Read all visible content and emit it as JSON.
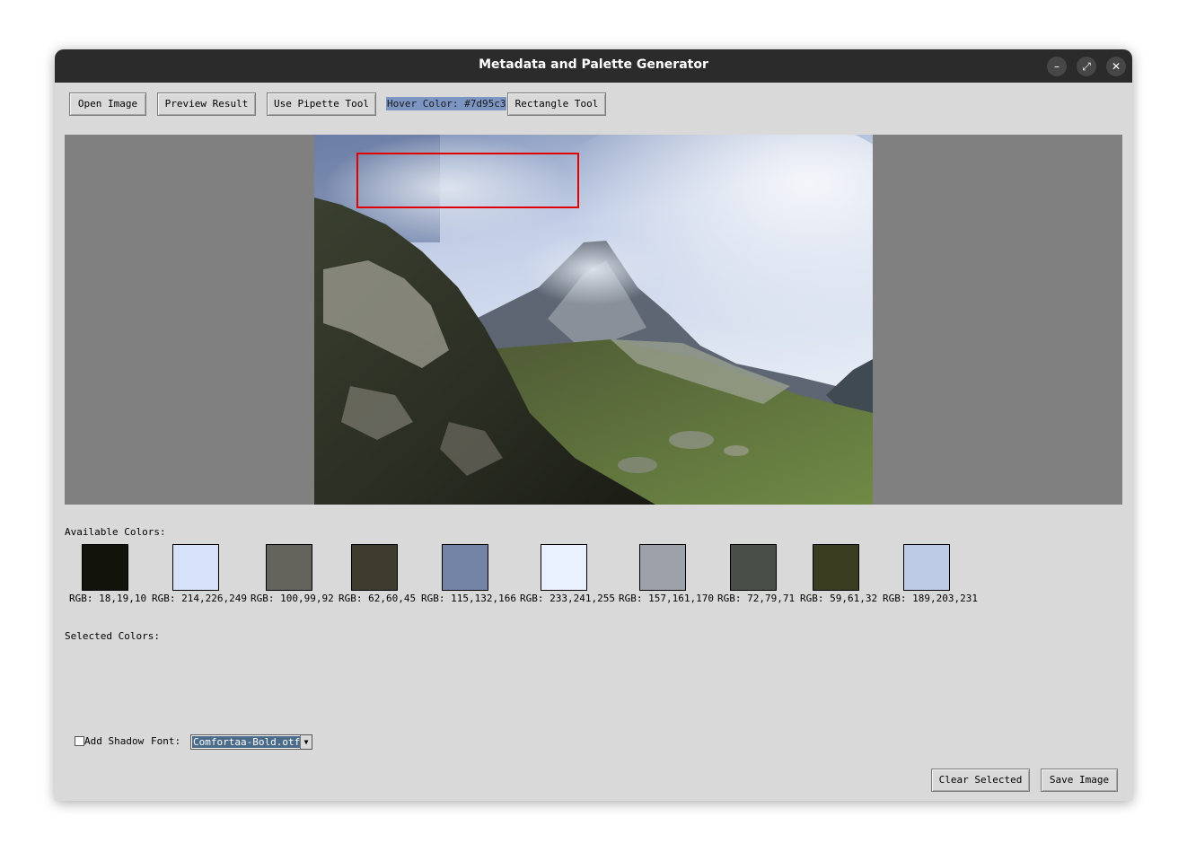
{
  "window": {
    "title": "Metadata and Palette Generator",
    "controls": [
      "minimize-icon",
      "maximize-icon",
      "close-icon"
    ]
  },
  "toolbar": {
    "open_image": "Open Image",
    "preview_result": "Preview Result",
    "use_pipette": "Use Pipette Tool",
    "hover_color": "Hover Color: #7d95c3",
    "hover_color_bg": "#7d95c3",
    "rectangle_tool": "Rectangle Tool"
  },
  "palette": {
    "available_label": "Available Colors:",
    "colors": [
      {
        "hex": "#12130a",
        "label": "RGB: 18,19,10"
      },
      {
        "hex": "#d6e2f9",
        "label": "RGB: 214,226,249"
      },
      {
        "hex": "#64635c",
        "label": "RGB: 100,99,92"
      },
      {
        "hex": "#3e3c2d",
        "label": "RGB: 62,60,45"
      },
      {
        "hex": "#7384a6",
        "label": "RGB: 115,132,166"
      },
      {
        "hex": "#e9f1ff",
        "label": "RGB: 233,241,255"
      },
      {
        "hex": "#9da1aa",
        "label": "RGB: 157,161,170"
      },
      {
        "hex": "#484f47",
        "label": "RGB: 72,79,71"
      },
      {
        "hex": "#3b3d20",
        "label": "RGB: 59,61,32"
      },
      {
        "hex": "#bdcbe7",
        "label": "RGB: 189,203,231"
      }
    ],
    "selected_label": "Selected Colors:"
  },
  "options": {
    "add_shadow": "Add Shadow",
    "font_label": "Font:",
    "font_value": "Comfortaa-Bold.otf"
  },
  "footer": {
    "clear_selected": "Clear Selected",
    "save_image": "Save Image"
  }
}
